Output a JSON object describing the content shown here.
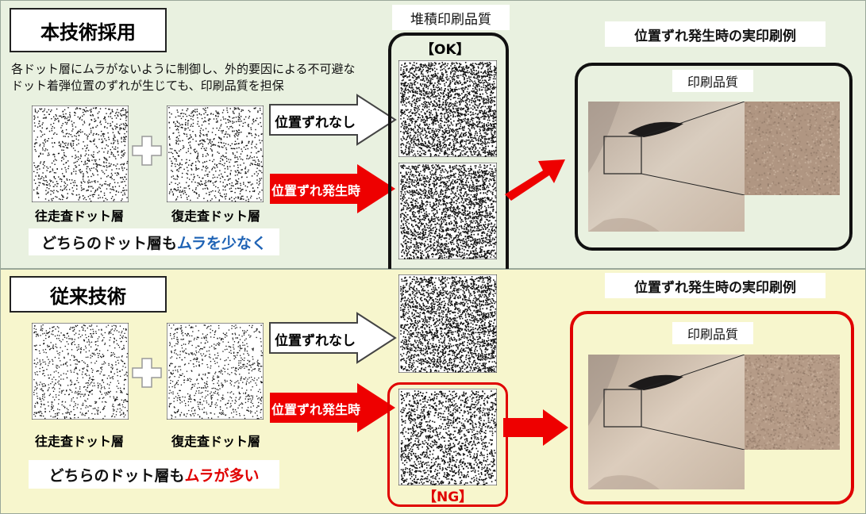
{
  "top": {
    "title": "本技術採用",
    "description_line1": "各ドット層にムラがないように制御し、外的要因による不可避な",
    "description_line2": "ドット着弾位置のずれが生じても、印刷品質を担保",
    "forward_layer_label": "往走査ドット層",
    "return_layer_label": "復走査ドット層",
    "summary_prefix": "どちらのドット層も",
    "summary_highlight": "ムラを少なく",
    "arrow_no_shift": "位置ずれなし",
    "arrow_shift": "位置ずれ発生時",
    "example_title": "位置ずれ発生時の実印刷例",
    "print_quality_label": "印刷品質"
  },
  "bottom": {
    "title": "従来技術",
    "forward_layer_label": "往走査ドット層",
    "return_layer_label": "復走査ドット層",
    "summary_prefix": "どちらのドット層も",
    "summary_highlight": "ムラが多い",
    "arrow_no_shift": "位置ずれなし",
    "arrow_shift": "位置ずれ発生時",
    "example_title": "位置ずれ発生時の実印刷例",
    "print_quality_label": "印刷品質"
  },
  "center": {
    "column_title": "堆積印刷品質",
    "ok_label": "【OK】",
    "ng_label": "【NG】"
  },
  "colors": {
    "top_panel_bg": "#e9f1e0",
    "bottom_panel_bg": "#f7f6cd",
    "accent_red": "#e00000",
    "highlight_blue": "#1f63b5"
  }
}
